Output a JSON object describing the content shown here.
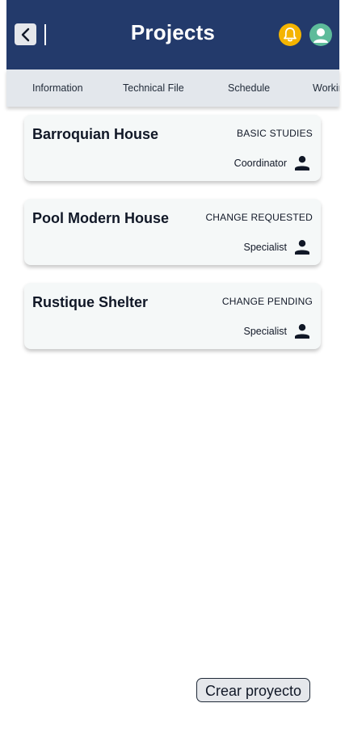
{
  "header": {
    "title": "Projects",
    "back_icon": "chevron-left-icon",
    "bell_icon": "bell-icon",
    "avatar_icon": "user-avatar-icon",
    "colors": {
      "background": "#233A6B",
      "bell": "#F4B400",
      "avatar": "#5DBB9A"
    }
  },
  "tabs": [
    {
      "label": "Information"
    },
    {
      "label": "Technical File"
    },
    {
      "label": "Schedule"
    },
    {
      "label": "Working"
    }
  ],
  "projects": [
    {
      "name": "Barroquian House",
      "status": "BASIC STUDIES",
      "role": "Coordinator",
      "icon": "person-icon"
    },
    {
      "name": "Pool Modern House",
      "status": "CHANGE REQUESTED",
      "role": "Specialist",
      "icon": "person-icon"
    },
    {
      "name": "Rustique Shelter",
      "status": "CHANGE PENDING",
      "role": "Specialist",
      "icon": "person-icon"
    }
  ],
  "create_button": {
    "label": "Crear proyecto"
  }
}
